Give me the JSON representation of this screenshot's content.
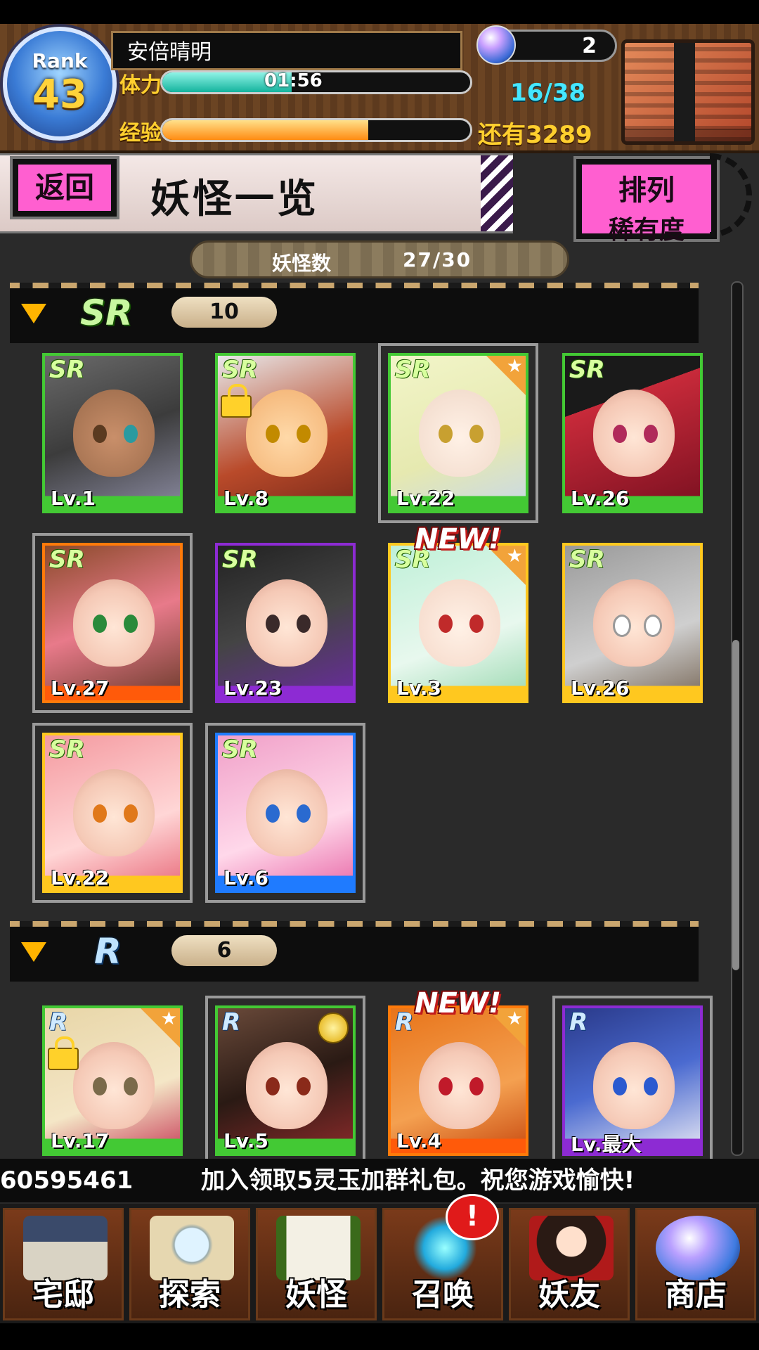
{
  "player": {
    "rank_label": "Rank",
    "rank": "43",
    "name": "安倍晴明",
    "gems": "2",
    "stamina_label": "体力",
    "stamina_timer": "01:56",
    "stamina_count": "16/38",
    "stamina_fraction": 0.42,
    "exp_label": "经验",
    "exp_remaining": "还有3289",
    "exp_fraction": 0.67
  },
  "title_bar": {
    "back_label": "返回",
    "page_title": "妖怪一览",
    "sort_label": "排列",
    "sort_value": "稀有度"
  },
  "yokai_count": {
    "label": "妖怪数",
    "value": "27/30"
  },
  "sections": [
    {
      "rarity": "SR",
      "count": "10",
      "cards": [
        {
          "rarity": "SR",
          "level": "Lv.1",
          "frame": "green"
        },
        {
          "rarity": "SR",
          "level": "Lv.8",
          "frame": "green",
          "locked": true
        },
        {
          "rarity": "SR",
          "level": "Lv.22",
          "frame": "green",
          "selected": true,
          "star": true
        },
        {
          "rarity": "SR",
          "level": "Lv.26",
          "frame": "green"
        },
        {
          "rarity": "SR",
          "level": "Lv.27",
          "frame": "orange",
          "selected": true
        },
        {
          "rarity": "SR",
          "level": "Lv.23",
          "frame": "purple"
        },
        {
          "rarity": "SR",
          "level": "Lv.3",
          "frame": "yellow",
          "star": true,
          "badge": "NEW!"
        },
        {
          "rarity": "SR",
          "level": "Lv.26",
          "frame": "yellow"
        },
        {
          "rarity": "SR",
          "level": "Lv.22",
          "frame": "yellow",
          "selected": true
        },
        {
          "rarity": "SR",
          "level": "Lv.6",
          "frame": "blue",
          "selected": true
        }
      ]
    },
    {
      "rarity": "R",
      "count": "6",
      "cards": [
        {
          "rarity": "R",
          "level": "Lv.17",
          "frame": "green",
          "locked": true,
          "star": true
        },
        {
          "rarity": "R",
          "level": "Lv.5",
          "frame": "green",
          "selected": true,
          "medal": true
        },
        {
          "rarity": "R",
          "level": "Lv.4",
          "frame": "orange",
          "star": true,
          "badge": "NEW!"
        },
        {
          "rarity": "R",
          "level": "Lv.最大",
          "frame": "purple",
          "selected": true
        }
      ]
    }
  ],
  "ticker": {
    "part1": "60595461",
    "part2": "加入领取5灵玉加群礼包。祝您游戏愉快!"
  },
  "nav": {
    "home": "宅邸",
    "explore": "探索",
    "yokai": "妖怪",
    "summon": "召唤",
    "friends": "妖友",
    "shop": "商店",
    "summon_alert": "!"
  },
  "colors": {
    "accent_pink": "#ff5fd0",
    "stamina": "#14b39d",
    "exp": "#ff8b12",
    "gold_text": "#ffcf2e"
  }
}
